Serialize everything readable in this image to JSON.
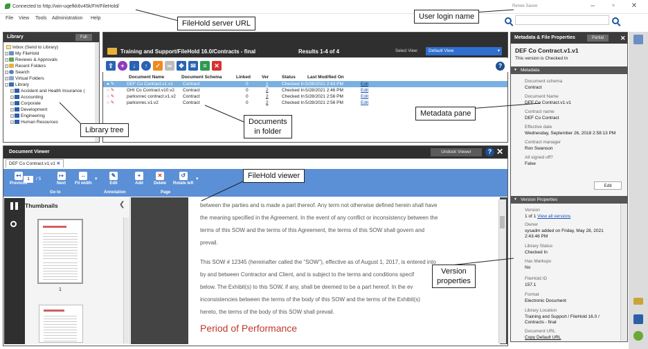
{
  "titlebar": {
    "url": "Connected to http://win-uqefkk6v45k/FH/FileHold/",
    "username": "Renee Sauve"
  },
  "menu": [
    "File",
    "View",
    "Tools",
    "Administration",
    "Help"
  ],
  "library": {
    "title": "Library",
    "mode_button": "Full",
    "items": [
      "Inbox (Send to Library)",
      "My FileHold",
      "Reviews & Approvals",
      "Recent Folders",
      "Search",
      "Virtual Folders",
      "Library",
      "Accident and Health Insurance (",
      "Accounting",
      "Corporate",
      "Development",
      "Engineering",
      "Human Resources"
    ]
  },
  "folder": {
    "title": "Training and Support/FileHold 16.0/Contracts - final",
    "results": "Results 1-4 of 4",
    "select_view_label": "Select View:",
    "select_view_value": "Default View",
    "columns": [
      "Document Name",
      "Document Schema",
      "Linked",
      "Ver",
      "Status",
      "Last Modified On"
    ],
    "rows": [
      {
        "name": "DEF Co Contract.v1.v1",
        "schema": "Contract",
        "linked": "0",
        "ver": "1",
        "status": "Checked In",
        "modified": "5/28/2021 2:43 PM",
        "action": "Edit"
      },
      {
        "name": "GHI Co Contract.v10.v2",
        "schema": "Contract",
        "linked": "0",
        "ver": "2",
        "status": "Checked In",
        "modified": "5/28/2021 2:46 PM",
        "action": "Edit"
      },
      {
        "name": "parksnrec contract.v1.v2",
        "schema": "Contract",
        "linked": "0",
        "ver": "2",
        "status": "Checked In",
        "modified": "5/28/2021 2:56 PM",
        "action": "Edit"
      },
      {
        "name": "parksnrec.v1.v2",
        "schema": "Contract",
        "linked": "0",
        "ver": "2",
        "status": "Checked In",
        "modified": "5/28/2021 2:56 PM",
        "action": "Edit"
      }
    ]
  },
  "meta": {
    "title": "Metadata & File Properties",
    "mode_button": "Partial",
    "doc_name": "DEF Co Contract.v1.v1",
    "doc_status": "This version is Checked In",
    "metadata_header": "Metadata",
    "fields": [
      {
        "label": "Document schema",
        "value": "Contract"
      },
      {
        "label": "Document Name",
        "value": "DEF Co Contract.v1.v1"
      },
      {
        "label": "Contract name",
        "value": "DEF Co Contract"
      },
      {
        "label": "Effective date",
        "value": "Wednesday, September 26, 2018 2:58:13 PM"
      },
      {
        "label": "Contract manager",
        "value": "Ron Swanson"
      },
      {
        "label": "All signed off?",
        "value": "False"
      }
    ],
    "edit_button": "Edit",
    "version_header": "Version Properties",
    "version_fields": [
      {
        "label": "Version",
        "value": "1 of 1",
        "link": "View all versions"
      },
      {
        "label": "Owner",
        "value": "sysadm added on Friday, May 28, 2021",
        "value2": "2:43:46 PM"
      },
      {
        "label": "Library Status",
        "value": "Checked In"
      },
      {
        "label": "Has Markups",
        "value": "No"
      },
      {
        "label": "FileHold ID",
        "value": "157.1"
      },
      {
        "label": "Format",
        "value": "Electronic Document"
      },
      {
        "label": "Library Location",
        "value": "Training and Support / FileHold 16.0 /",
        "value2": "Contracts - final"
      },
      {
        "label": "Document URL",
        "link": "Copy Default URL"
      }
    ]
  },
  "viewer": {
    "title": "Document Viewer",
    "undock": "Undock Viewer",
    "tab": "DEF Co Contract.v1.v1",
    "page_current": "1",
    "page_total": "/ 5",
    "ribbon": {
      "previous": "Previous",
      "next": "Next",
      "fit_width": "Fit width",
      "edit": "Edit",
      "add": "Add",
      "delete": "Delete",
      "rotate_left": "Rotate left",
      "group_goto": "Go to",
      "group_annotation": "Annotation",
      "group_page": "Page"
    },
    "thumbnails_title": "Thumbnails",
    "thumb_page_number": "1",
    "doc_text": [
      "between the parties and is made a part thereof. Any term not otherwise defined herein shall have",
      "the meaning specified in the Agreement. In the event of any conflict or inconsistency between the",
      "terms of this SOW and the terms of this Agreement, the terms of this SOW shall govern and",
      "prevail.",
      "This SOW # 12345 (hereinafter called the \"SOW\"), effective as of August 1, 2017, is entered into",
      "by and between Contractor and Client, and is subject to the terms and conditions specif",
      "below. The Exhibit(s) to this SOW, if any, shall be deemed to be a part hereof. In the ev",
      "inconsistencies between the terms of the body of this SOW and the terms of the Exhibit(s)",
      "hereto, the terms of the body of this SOW shall prevail."
    ],
    "doc_heading": "Period of Performance"
  },
  "callouts": {
    "server_url": "FileHold server URL",
    "login_name": "User login name",
    "library_tree": "Library tree",
    "documents": "Documents",
    "documents2": "in folder",
    "metadata_pane": "Metadata pane",
    "viewer": "FileHold viewer",
    "version": "Version",
    "version2": "properties"
  }
}
